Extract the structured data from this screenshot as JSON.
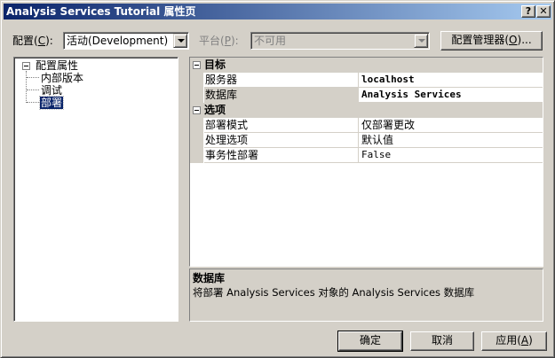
{
  "window": {
    "title": "Analysis Services Tutorial 属性页",
    "help_btn": "?",
    "close_btn": "✕"
  },
  "toolbar": {
    "config_label": "配置",
    "config_accel": "C",
    "config_value": "活动(Development)",
    "platform_label": "平台",
    "platform_accel": "P",
    "platform_value": "不可用",
    "config_manager_label": "配置管理器",
    "config_manager_accel": "O",
    "config_manager_ellipsis": "..."
  },
  "tree": {
    "root": "配置属性",
    "items": [
      "内部版本",
      "调试",
      "部署"
    ]
  },
  "grid": {
    "categories": [
      {
        "label": "目标",
        "rows": [
          {
            "name": "服务器",
            "value": "localhost"
          },
          {
            "name": "数据库",
            "value": "Analysis Services"
          }
        ]
      },
      {
        "label": "选项",
        "rows": [
          {
            "name": "部署模式",
            "value": "仅部署更改"
          },
          {
            "name": "处理选项",
            "value": "默认值"
          },
          {
            "name": "事务性部署",
            "value": "False"
          }
        ]
      }
    ]
  },
  "description": {
    "title": "数据库",
    "body": "将部署 Analysis Services 对象的 Analysis Services 数据库"
  },
  "buttons": {
    "ok": "确定",
    "cancel": "取消",
    "apply_label": "应用",
    "apply_accel": "A"
  }
}
